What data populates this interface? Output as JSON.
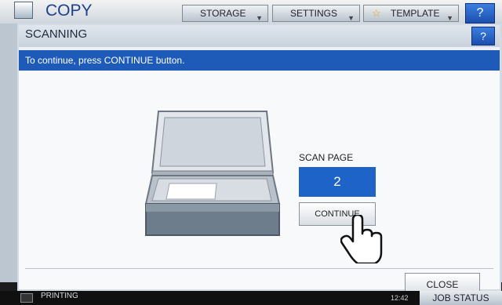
{
  "app": {
    "title": "COPY",
    "icon": "copy-app-icon"
  },
  "top_tabs": [
    {
      "label": "STORAGE"
    },
    {
      "label": "SETTINGS"
    },
    {
      "label": "TEMPLATE",
      "icon": "star-icon"
    }
  ],
  "top_help_label": "?",
  "dialog": {
    "title": "SCANNING",
    "help_label": "?",
    "message": "To continue, press CONTINUE button.",
    "scan_page_label": "SCAN PAGE",
    "scan_page_value": "2",
    "continue_label": "CONTINUE",
    "close_label": "CLOSE"
  },
  "statusbar": {
    "printing_label": "PRINTING",
    "time": "12:42",
    "job_status_label": "JOB STATUS"
  },
  "colors": {
    "accent_blue": "#1e5bb8",
    "page_box_blue": "#1e63c7",
    "help_blue": "#2b66c9"
  }
}
